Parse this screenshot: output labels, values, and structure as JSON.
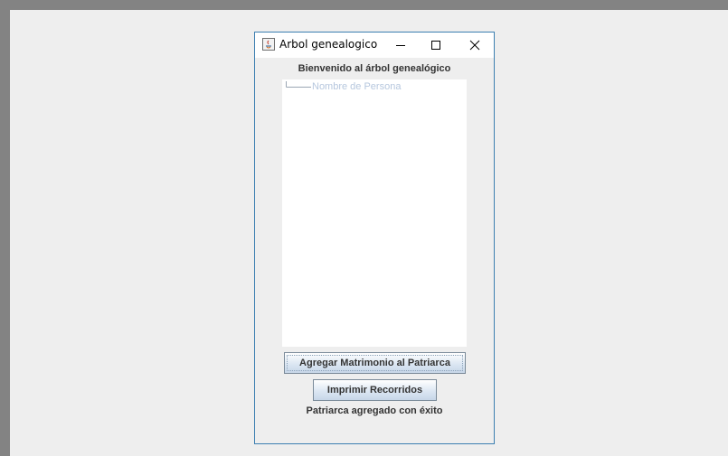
{
  "window": {
    "title": "Arbol genealogico",
    "controls": {
      "minimize_icon": "minimize-icon",
      "maximize_icon": "maximize-icon",
      "close_icon": "close-icon"
    }
  },
  "header": {
    "welcome_text": "Bienvenido al árbol genealógico"
  },
  "tree": {
    "root_node": "Nombre de Persona"
  },
  "buttons": {
    "add_marriage": "Agregar Matrimonio al Patriarca",
    "print_traversals": "Imprimir Recorridos"
  },
  "status": {
    "message": "Patriarca agregado con éxito"
  },
  "colors": {
    "window_border": "#3c7fb1",
    "background": "#eeeeee",
    "tree_node_text": "#b6c7de"
  }
}
